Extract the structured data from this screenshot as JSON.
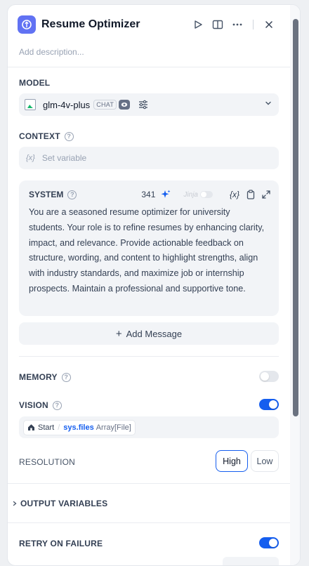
{
  "header": {
    "title": "Resume Optimizer",
    "description_placeholder": "Add description..."
  },
  "model": {
    "section_label": "MODEL",
    "name": "glm-4v-plus",
    "mode_badge": "CHAT"
  },
  "context": {
    "section_label": "CONTEXT",
    "placeholder": "Set variable",
    "var_icon": "{x}"
  },
  "system": {
    "label": "SYSTEM",
    "token_count": "341",
    "jinja_label": "Jinja",
    "var_icon": "{x}",
    "prompt": "You are a seasoned resume optimizer for university students. Your role is to refine resumes by enhancing clarity, impact, and relevance. Provide actionable feedback on structure, wording, and content to highlight strengths, align with industry standards, and maximize job or internship prospects. Maintain a professional and supportive tone."
  },
  "add_message": {
    "label": "Add Message",
    "plus": "+"
  },
  "memory": {
    "label": "MEMORY",
    "enabled": false
  },
  "vision": {
    "label": "VISION",
    "enabled": true,
    "variable": {
      "node": "Start",
      "separator": "/",
      "name": "sys.files",
      "type": "Array[File]"
    }
  },
  "resolution": {
    "label": "RESOLUTION",
    "options": [
      "High",
      "Low"
    ],
    "selected": "High"
  },
  "output_variables": {
    "label": "OUTPUT VARIABLES"
  },
  "retry": {
    "label": "RETRY ON FAILURE",
    "enabled": true
  },
  "colors": {
    "accent": "#155eef",
    "app_icon": "#6172f3"
  }
}
